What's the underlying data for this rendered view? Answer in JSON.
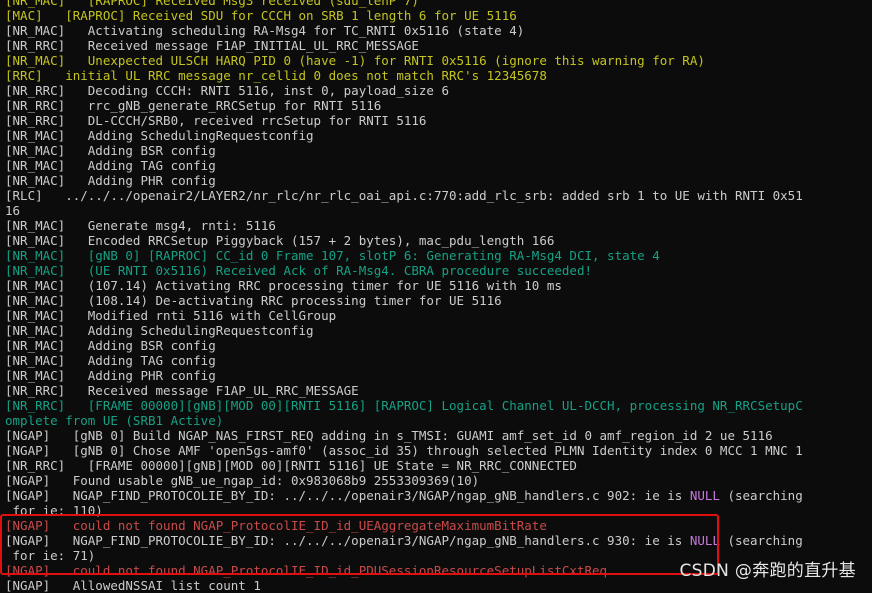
{
  "colors": {
    "background": "#0c0c0c",
    "default": "#cccccc",
    "yellow": "#c4c41f",
    "green": "#16a085",
    "red": "#c94a4a",
    "magenta": "#c678dd",
    "highlight_border": "#e01010"
  },
  "log_lines": [
    {
      "color": "yellow",
      "segments": [
        {
          "t": "[NR_MAC]   [RAPROC] Received Msg3 received (sdu_lenP 7)"
        }
      ]
    },
    {
      "color": "yellow",
      "segments": [
        {
          "t": "[MAC]   [RAPROC] Received SDU for CCCH on SRB 1 length 6 for UE 5116"
        }
      ]
    },
    {
      "color": "white",
      "segments": [
        {
          "t": "[NR_MAC]   Activating scheduling RA-Msg4 for TC_RNTI 0x5116 (state 4)"
        }
      ]
    },
    {
      "color": "white",
      "segments": [
        {
          "t": "[NR_RRC]   Received message F1AP_INITIAL_UL_RRC_MESSAGE"
        }
      ]
    },
    {
      "color": "yellow",
      "segments": [
        {
          "t": "[NR_MAC]   Unexpected ULSCH HARQ PID 0 (have -1) for RNTI 0x5116 (ignore this warning for RA)"
        }
      ]
    },
    {
      "color": "yellow",
      "segments": [
        {
          "t": "[RRC]   initial UL RRC message nr_cellid 0 does not match RRC's 12345678"
        }
      ]
    },
    {
      "color": "white",
      "segments": [
        {
          "t": "[NR_RRC]   Decoding CCCH: RNTI 5116, inst 0, payload_size 6"
        }
      ]
    },
    {
      "color": "white",
      "segments": [
        {
          "t": "[NR_RRC]   rrc_gNB_generate_RRCSetup for RNTI 5116"
        }
      ]
    },
    {
      "color": "white",
      "segments": [
        {
          "t": "[NR_RRC]   DL-CCCH/SRB0, received rrcSetup for RNTI 5116"
        }
      ]
    },
    {
      "color": "white",
      "segments": [
        {
          "t": "[NR_MAC]   Adding SchedulingRequestconfig"
        }
      ]
    },
    {
      "color": "white",
      "segments": [
        {
          "t": "[NR_MAC]   Adding BSR config"
        }
      ]
    },
    {
      "color": "white",
      "segments": [
        {
          "t": "[NR_MAC]   Adding TAG config"
        }
      ]
    },
    {
      "color": "white",
      "segments": [
        {
          "t": "[NR_MAC]   Adding PHR config"
        }
      ]
    },
    {
      "color": "white",
      "segments": [
        {
          "t": "[RLC]   ../../../openair2/LAYER2/nr_rlc/nr_rlc_oai_api.c:770:add_rlc_srb: added srb 1 to UE with RNTI 0x51"
        }
      ]
    },
    {
      "color": "white",
      "segments": [
        {
          "t": "16"
        }
      ]
    },
    {
      "color": "white",
      "segments": [
        {
          "t": "[NR_MAC]   Generate msg4, rnti: 5116"
        }
      ]
    },
    {
      "color": "white",
      "segments": [
        {
          "t": "[NR_MAC]   Encoded RRCSetup Piggyback (157 + 2 bytes), mac_pdu_length 166"
        }
      ]
    },
    {
      "color": "green",
      "segments": [
        {
          "t": "[NR_MAC]   [gNB 0] [RAPROC] CC_id 0 Frame 107, slotP 6: Generating RA-Msg4 DCI, state 4"
        }
      ]
    },
    {
      "color": "green",
      "segments": [
        {
          "t": "[NR_MAC]   (UE RNTI 0x5116) Received Ack of RA-Msg4. CBRA procedure succeeded!"
        }
      ]
    },
    {
      "color": "white",
      "segments": [
        {
          "t": "[NR_MAC]   (107.14) Activating RRC processing timer for UE 5116 with 10 ms"
        }
      ]
    },
    {
      "color": "white",
      "segments": [
        {
          "t": "[NR_MAC]   (108.14) De-activating RRC processing timer for UE 5116"
        }
      ]
    },
    {
      "color": "white",
      "segments": [
        {
          "t": "[NR_MAC]   Modified rnti 5116 with CellGroup"
        }
      ]
    },
    {
      "color": "white",
      "segments": [
        {
          "t": "[NR_MAC]   Adding SchedulingRequestconfig"
        }
      ]
    },
    {
      "color": "white",
      "segments": [
        {
          "t": "[NR_MAC]   Adding BSR config"
        }
      ]
    },
    {
      "color": "white",
      "segments": [
        {
          "t": "[NR_MAC]   Adding TAG config"
        }
      ]
    },
    {
      "color": "white",
      "segments": [
        {
          "t": "[NR_MAC]   Adding PHR config"
        }
      ]
    },
    {
      "color": "white",
      "segments": [
        {
          "t": "[NR_RRC]   Received message F1AP_UL_RRC_MESSAGE"
        }
      ]
    },
    {
      "color": "green",
      "segments": [
        {
          "t": "[NR_RRC]   [FRAME 00000][gNB][MOD 00][RNTI 5116] [RAPROC] Logical Channel UL-DCCH, processing NR_RRCSetupC"
        }
      ]
    },
    {
      "color": "green",
      "segments": [
        {
          "t": "omplete from UE (SRB1 Active)"
        }
      ]
    },
    {
      "color": "white",
      "segments": [
        {
          "t": "[NGAP]   [gNB 0] Build NGAP_NAS_FIRST_REQ adding in s_TMSI: GUAMI amf_set_id 0 amf_region_id 2 ue 5116"
        }
      ]
    },
    {
      "color": "white",
      "segments": [
        {
          "t": "[NGAP]   [gNB 0] Chose AMF 'open5gs-amf0' (assoc_id 35) through selected PLMN Identity index 0 MCC 1 MNC 1"
        }
      ]
    },
    {
      "color": "white",
      "segments": [
        {
          "t": "[NR_RRC]   [FRAME 00000][gNB][MOD 00][RNTI 5116] UE State = NR_RRC_CONNECTED"
        }
      ]
    },
    {
      "color": "white",
      "segments": [
        {
          "t": "[NGAP]   Found usable gNB_ue_ngap_id: 0x983068b9 2553309369(10)"
        }
      ]
    },
    {
      "color": "white",
      "segments": [
        {
          "t": "[NGAP]   NGAP_FIND_PROTOCOLIE_BY_ID: ../../../openair3/NGAP/ngap_gNB_handlers.c 902: ie is "
        },
        {
          "t": "NULL",
          "color": "magenta"
        },
        {
          "t": " (searching"
        }
      ]
    },
    {
      "color": "white",
      "segments": [
        {
          "t": " for ie: 110)"
        }
      ]
    },
    {
      "color": "red",
      "segments": [
        {
          "t": "[NGAP]   could not found NGAP_ProtocolIE_ID_id_UEAggregateMaximumBitRate"
        }
      ]
    },
    {
      "color": "white",
      "segments": [
        {
          "t": "[NGAP]   NGAP_FIND_PROTOCOLIE_BY_ID: ../../../openair3/NGAP/ngap_gNB_handlers.c 930: ie is "
        },
        {
          "t": "NULL",
          "color": "magenta"
        },
        {
          "t": " (searching"
        }
      ]
    },
    {
      "color": "white",
      "segments": [
        {
          "t": " for ie: 71)"
        }
      ]
    },
    {
      "color": "red",
      "segments": [
        {
          "t": "[NGAP]   could not found NGAP_ProtocolIE_ID_id_PDUSessionResourceSetupListCxtReq"
        }
      ]
    },
    {
      "color": "white",
      "segments": [
        {
          "t": "[NGAP]   AllowedNSSAI list count 1"
        }
      ]
    }
  ],
  "watermark": "CSDN @奔跑的直升基"
}
